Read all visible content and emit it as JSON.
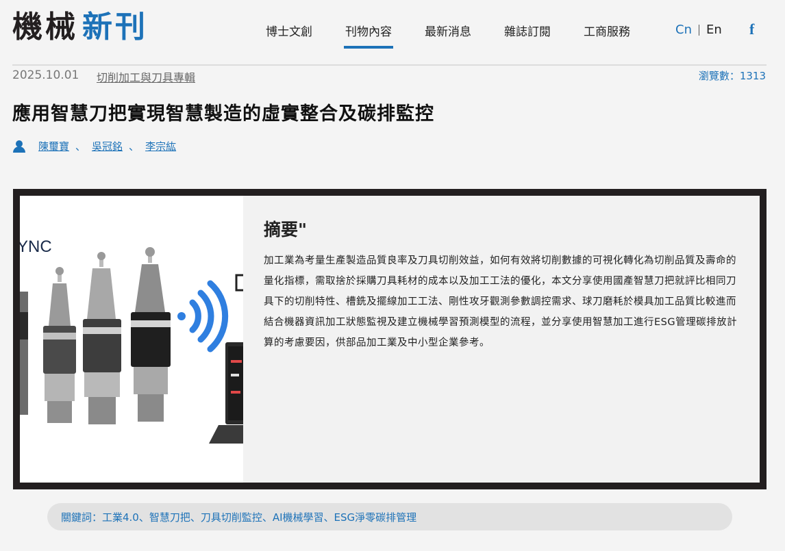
{
  "header": {
    "logo": {
      "part1": "機械",
      "part2": "新刊"
    },
    "nav": [
      {
        "label": "博士文創"
      },
      {
        "label": "刊物內容",
        "active": true
      },
      {
        "label": "最新消息"
      },
      {
        "label": "雜誌訂閱"
      },
      {
        "label": "工商服務"
      }
    ],
    "lang": {
      "cn": "Cn",
      "en": "En"
    },
    "social_icon": "facebook-icon"
  },
  "meta": {
    "date": "2025.10.01",
    "category": "切削加工與刀具專輯",
    "views": "瀏覽數：1313"
  },
  "article": {
    "title": "應用智慧刀把實現智慧製造的虛實整合及碳排監控",
    "authors": [
      "陳璽寶",
      "吳冠銘",
      "李宗紘"
    ],
    "author_separator": "、",
    "image_text": "YNC",
    "abstract_heading": "摘要\"",
    "abstract_text": "加工業為考量生產製造品質良率及刀具切削效益，如何有效將切削數據的可視化轉化為切削品質及壽命的量化指標，需取捨於採購刀具耗材的成本以及加工工法的優化，本文分享使用國產智慧刀把就評比相同刀具下的切削特性、槽銑及擺線加工工法、剛性攻牙觀測參數調控需求、球刀磨耗於模具加工品質比較進而結合機器資訊加工狀態監視及建立機械學習預測模型的流程，並分享使用智慧加工進行ESG管理碳排放計算的考慮要因，供部品加工業及中小型企業參考。",
    "keywords": "關鍵詞：工業4.0、智慧刀把、刀具切削監控、AI機械學習、ESG淨零碳排管理"
  },
  "colors": {
    "accent": "#1d72b8",
    "frame": "#231f20"
  }
}
